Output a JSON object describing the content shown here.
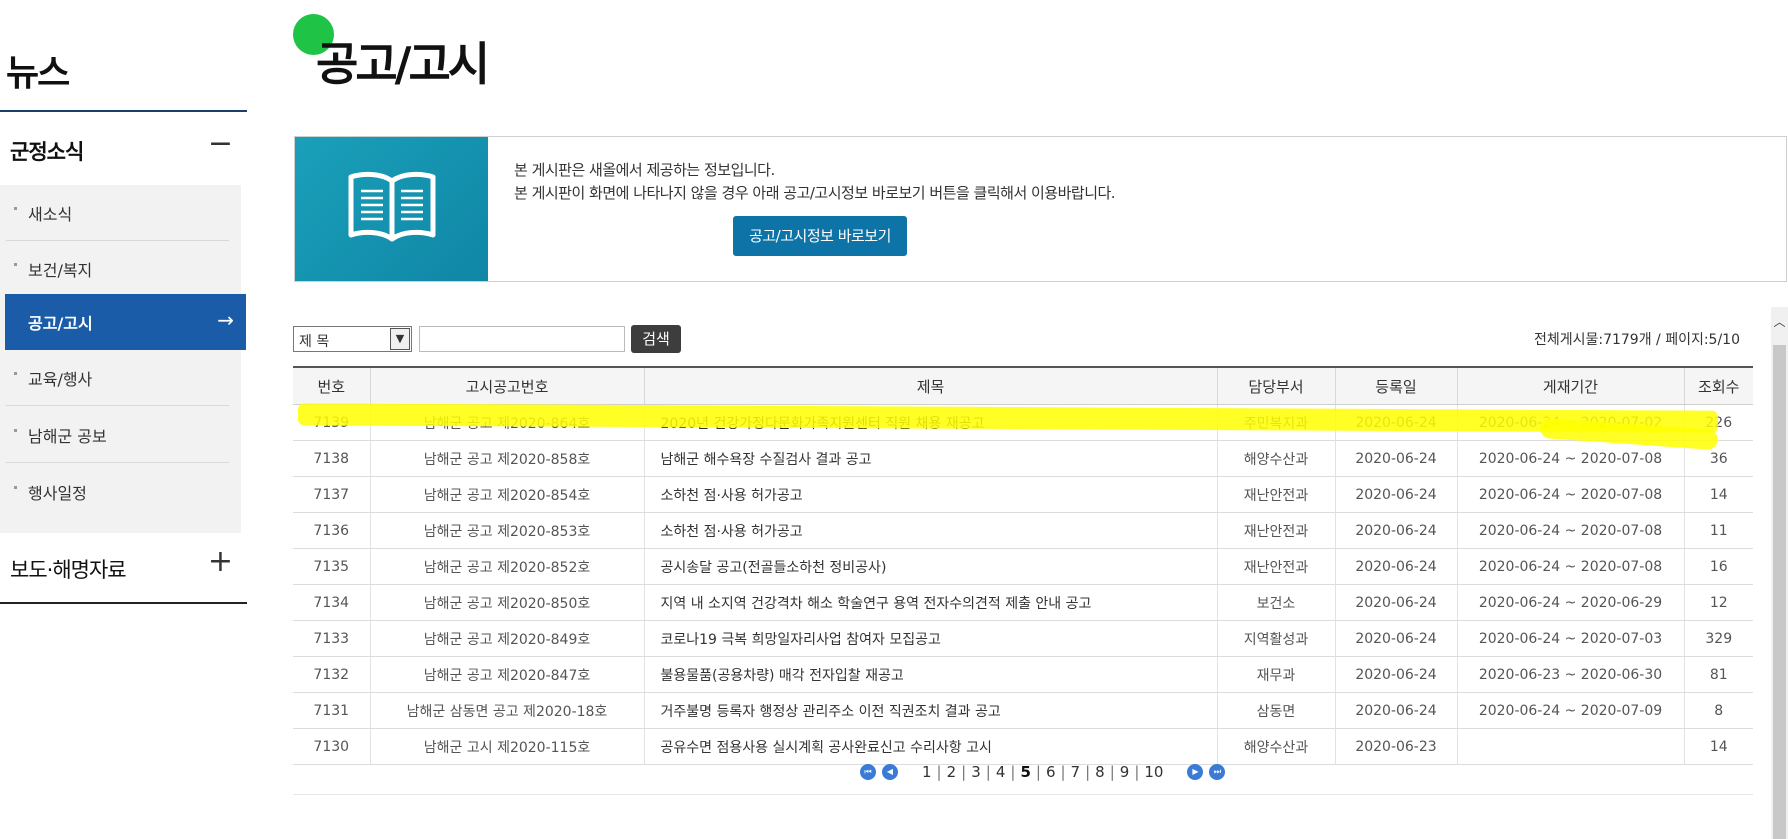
{
  "sidebar": {
    "title": "뉴스",
    "group1": {
      "label": "군정소식",
      "symbol": "−"
    },
    "items": [
      {
        "label": "새소식"
      },
      {
        "label": "보건/복지"
      },
      {
        "label": "공고/고시",
        "arrow": "→"
      },
      {
        "label": "교육/행사"
      },
      {
        "label": "남해군 공보"
      },
      {
        "label": "행사일정"
      }
    ],
    "group2": {
      "label": "보도·해명자료",
      "symbol": "+"
    }
  },
  "page": {
    "title": "공고/고시"
  },
  "notice": {
    "line1": "본 게시판은 새올에서 제공하는 정보입니다.",
    "line2": "본 게시판이 화면에 나타나지 않을 경우 아래 공고/고시정보 바로보기 버튼을 클릭해서 이용바랍니다.",
    "button": "공고/고시정보 바로보기",
    "icon": "book-icon"
  },
  "search": {
    "select_value": "제 목",
    "input_value": "",
    "button": "검색"
  },
  "total": "전체게시물:7179개 / 페이지:5/10",
  "table": {
    "headers": [
      "번호",
      "고시공고번호",
      "제목",
      "담당부서",
      "등록일",
      "게재기간",
      "조회수"
    ],
    "rows": [
      [
        "7139",
        "남해군 공고 제2020-864호",
        "2020년 건강가정다문화가족지원센터 직원 채용 재공고",
        "주민복지과",
        "2020-06-24",
        "2020-06-24 ~ 2020-07-02",
        "226"
      ],
      [
        "7138",
        "남해군 공고 제2020-858호",
        "남해군 해수욕장 수질검사 결과 공고",
        "해양수산과",
        "2020-06-24",
        "2020-06-24 ~ 2020-07-08",
        "36"
      ],
      [
        "7137",
        "남해군 공고 제2020-854호",
        "소하천 점·사용 허가공고",
        "재난안전과",
        "2020-06-24",
        "2020-06-24 ~ 2020-07-08",
        "14"
      ],
      [
        "7136",
        "남해군 공고 제2020-853호",
        "소하천 점·사용 허가공고",
        "재난안전과",
        "2020-06-24",
        "2020-06-24 ~ 2020-07-08",
        "11"
      ],
      [
        "7135",
        "남해군 공고 제2020-852호",
        "공시송달 공고(전골들소하천 정비공사)",
        "재난안전과",
        "2020-06-24",
        "2020-06-24 ~ 2020-07-08",
        "16"
      ],
      [
        "7134",
        "남해군 공고 제2020-850호",
        "지역 내 소지역 건강격차 해소 학술연구 용역 전자수의견적 제출 안내 공고",
        "보건소",
        "2020-06-24",
        "2020-06-24 ~ 2020-06-29",
        "12"
      ],
      [
        "7133",
        "남해군 공고 제2020-849호",
        "코로나19 극복 희망일자리사업 참여자 모집공고",
        "지역활성과",
        "2020-06-24",
        "2020-06-24 ~ 2020-07-03",
        "329"
      ],
      [
        "7132",
        "남해군 공고 제2020-847호",
        "불용물품(공용차량) 매각 전자입찰 재공고",
        "재무과",
        "2020-06-24",
        "2020-06-23 ~ 2020-06-30",
        "81"
      ],
      [
        "7131",
        "남해군 삼동면 공고 제2020-18호",
        "거주불명 등록자 행정상 관리주소 이전 직권조치 결과 공고",
        "삼동면",
        "2020-06-24",
        "2020-06-24 ~ 2020-07-09",
        "8"
      ],
      [
        "7130",
        "남해군 고시 제2020-115호",
        "공유수면 점용사용 실시계획 공사완료신고 수리사항 고시",
        "해양수산과",
        "2020-06-23",
        "",
        "14"
      ]
    ]
  },
  "pagination": {
    "pages": [
      "1",
      "2",
      "3",
      "4",
      "5",
      "6",
      "7",
      "8",
      "9",
      "10"
    ],
    "current": "5"
  },
  "colors": {
    "active": "#1a5ca8",
    "button": "#0e73a6",
    "highlight": "#ffff00",
    "dot": "#1fc446"
  }
}
